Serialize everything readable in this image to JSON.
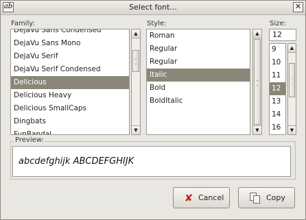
{
  "window": {
    "title": "Select font..."
  },
  "family": {
    "label": "Family:",
    "items": [
      "DejaVu Sans Condensed",
      "DejaVu Sans Mono",
      "DejaVu Serif",
      "DejaVu Serif Condensed",
      "Delicious",
      "Delicious Heavy",
      "Delicious SmallCaps",
      "Dingbats",
      "FunBandal"
    ],
    "selected": "Delicious"
  },
  "style": {
    "label": "Style:",
    "items": [
      "Roman",
      "Regular",
      "Regular",
      "Italic",
      "Bold",
      "BoldItalic"
    ],
    "selected": "Italic"
  },
  "size": {
    "label": "Size:",
    "value": "12",
    "items": [
      "9",
      "10",
      "11",
      "12",
      "13",
      "14",
      "16"
    ],
    "selected": "12"
  },
  "preview": {
    "label": "Preview:",
    "text": "abcdefghijk ABCDEFGHIJK"
  },
  "buttons": {
    "cancel": "Cancel",
    "copy": "Copy"
  },
  "icons": {
    "app": "font-app-icon",
    "close": "close-icon",
    "cancel": "x-icon",
    "copy": "copy-icon"
  },
  "colors": {
    "selection": "#8b8778",
    "background": "#e9e7e2"
  }
}
